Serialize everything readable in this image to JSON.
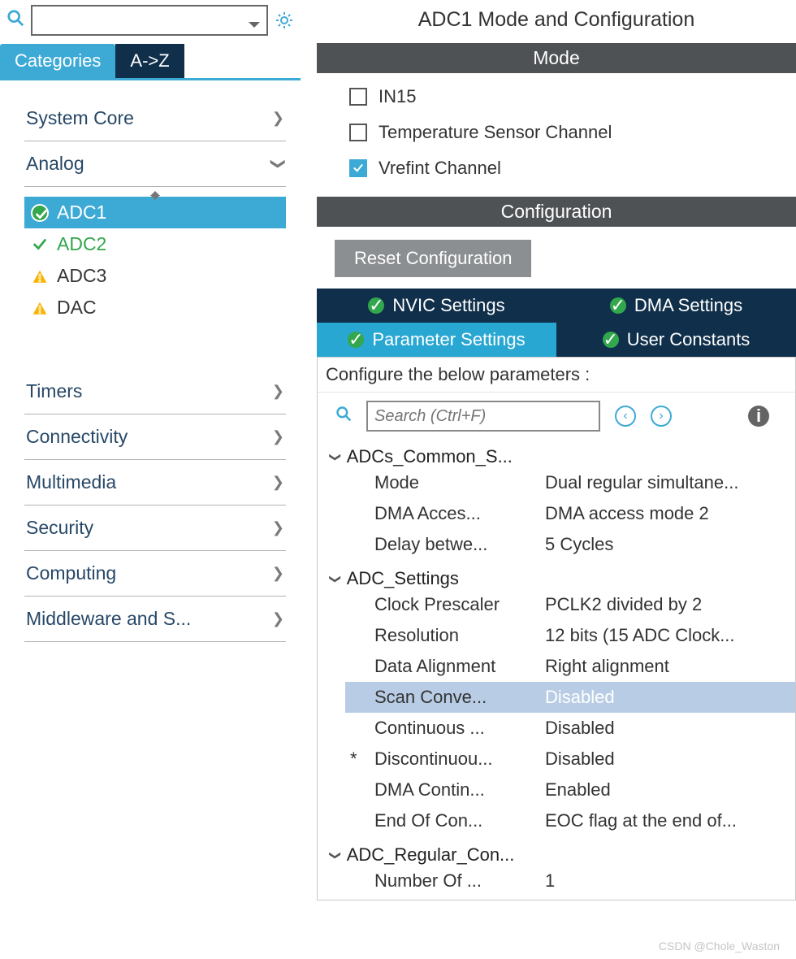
{
  "sidebar": {
    "search_placeholder": "",
    "view_tabs": {
      "categories": "Categories",
      "az": "A->Z"
    },
    "categories": [
      {
        "label": "System Core",
        "expanded": false
      },
      {
        "label": "Analog",
        "expanded": true,
        "items": [
          {
            "label": "ADC1",
            "status": "configured",
            "selected": true
          },
          {
            "label": "ADC2",
            "status": "configured",
            "selected": false
          },
          {
            "label": "ADC3",
            "status": "warning",
            "selected": false
          },
          {
            "label": "DAC",
            "status": "warning",
            "selected": false
          }
        ]
      },
      {
        "label": "Timers",
        "expanded": false
      },
      {
        "label": "Connectivity",
        "expanded": false
      },
      {
        "label": "Multimedia",
        "expanded": false
      },
      {
        "label": "Security",
        "expanded": false
      },
      {
        "label": "Computing",
        "expanded": false
      },
      {
        "label": "Middleware and S...",
        "expanded": false
      }
    ]
  },
  "main": {
    "title": "ADC1 Mode and Configuration",
    "mode_header": "Mode",
    "mode_options": [
      {
        "label": "IN15",
        "checked": false
      },
      {
        "label": "Temperature Sensor Channel",
        "checked": false
      },
      {
        "label": "Vrefint Channel",
        "checked": true
      }
    ],
    "config_header": "Configuration",
    "reset_label": "Reset Configuration",
    "cfg_tabs": {
      "nvic": "NVIC Settings",
      "dma": "DMA Settings",
      "param": "Parameter Settings",
      "user": "User Constants"
    },
    "params_hint": "Configure the below parameters :",
    "param_search_placeholder": "Search (Ctrl+F)",
    "param_groups": [
      {
        "name": "ADCs_Common_S...",
        "rows": [
          {
            "marker": "",
            "name": "Mode",
            "value": "Dual regular simultane..."
          },
          {
            "marker": "",
            "name": "DMA Acces...",
            "value": "DMA access mode 2"
          },
          {
            "marker": "",
            "name": "Delay betwe...",
            "value": "5 Cycles"
          }
        ]
      },
      {
        "name": "ADC_Settings",
        "rows": [
          {
            "marker": "",
            "name": "Clock Prescaler",
            "value": "PCLK2 divided by 2"
          },
          {
            "marker": "",
            "name": "Resolution",
            "value": "12 bits (15 ADC Clock..."
          },
          {
            "marker": "",
            "name": "Data Alignment",
            "value": "Right alignment"
          },
          {
            "marker": "",
            "name": "Scan Conve...",
            "value": "Disabled",
            "selected": true
          },
          {
            "marker": "",
            "name": "Continuous ...",
            "value": "Disabled"
          },
          {
            "marker": "*",
            "name": "Discontinuou...",
            "value": "Disabled"
          },
          {
            "marker": "",
            "name": "DMA Contin...",
            "value": "Enabled"
          },
          {
            "marker": "",
            "name": "End Of Con...",
            "value": "EOC flag at the end of..."
          }
        ]
      },
      {
        "name": "ADC_Regular_Con...",
        "rows": [
          {
            "marker": "",
            "name": "Number Of ...",
            "value": "1"
          }
        ]
      }
    ]
  },
  "watermark": "CSDN @Chole_Waston"
}
